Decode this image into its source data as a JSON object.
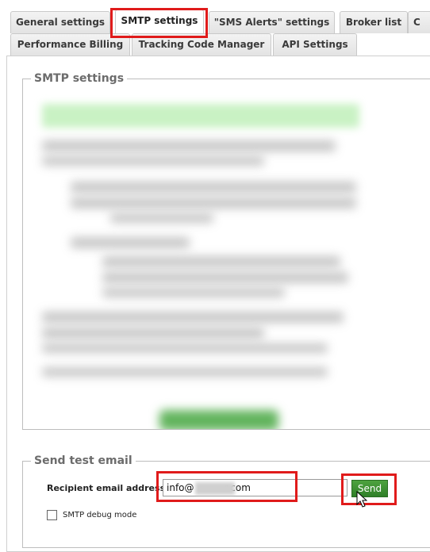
{
  "tabs": {
    "row1": [
      {
        "label": "General settings"
      },
      {
        "label": "SMTP settings"
      },
      {
        "label": "\"SMS Alerts\" settings"
      },
      {
        "label": "Broker list"
      },
      {
        "label": "C"
      }
    ],
    "row2": [
      {
        "label": "Performance Billing"
      },
      {
        "label": "Tracking Code Manager"
      },
      {
        "label": "API Settings"
      }
    ],
    "active": "SMTP settings"
  },
  "smtp_section": {
    "legend": "SMTP settings"
  },
  "test_email": {
    "legend": "Send test email",
    "recipient_label": "Recipient email address",
    "required_mark": "*",
    "email_value_prefix": "info@",
    "email_value_suffix": "r.com",
    "email_value": "info@          r.com",
    "send_label": "Send",
    "debug_label": "SMTP debug mode",
    "debug_checked": false
  },
  "colors": {
    "highlight": "#e01b1b",
    "send_button": "#3a8f30"
  }
}
